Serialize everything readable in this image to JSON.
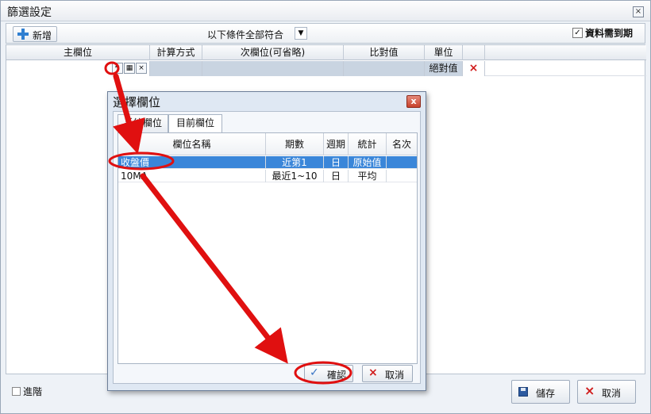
{
  "window": {
    "title": "篩選設定",
    "close_glyph": "×"
  },
  "toolbar": {
    "add_label": "新增",
    "condition_mode": "以下條件全部符合",
    "expire_label": "資料需到期",
    "expire_checked": "✓"
  },
  "grid": {
    "columns": [
      "主欄位",
      "計算方式",
      "次欄位(可省略)",
      "比對值",
      "單位"
    ],
    "row": {
      "unit": "絕對值"
    }
  },
  "bottom": {
    "advanced_label": "進階",
    "save_label": "儲存",
    "cancel_label": "取消"
  },
  "dialog": {
    "title": "選擇欄位",
    "tabs": [
      "系統欄位",
      "目前欄位"
    ],
    "columns": [
      "欄位名稱",
      "期數",
      "週期",
      "統計",
      "名次"
    ],
    "rows": [
      {
        "name": "收盤價",
        "period": "近第1",
        "cycle": "日",
        "stat": "原始值",
        "rank": ""
      },
      {
        "name": "10MA",
        "period": "最近1~10",
        "cycle": "日",
        "stat": "平均",
        "rank": ""
      }
    ],
    "ok_label": "確認",
    "cancel_label": "取消"
  },
  "colors": {
    "accent_blue": "#3a86d9",
    "annotation_red": "#e01010"
  }
}
